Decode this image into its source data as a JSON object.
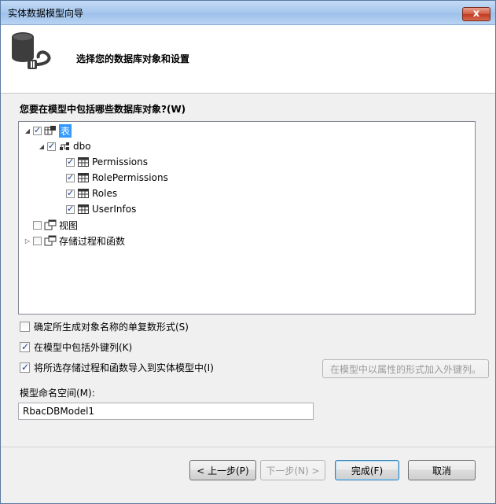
{
  "window": {
    "title": "实体数据模型向导",
    "close_label": "x"
  },
  "header": {
    "heading": "选择您的数据库对象和设置",
    "icon": "database-plug-icon"
  },
  "prompt": "您要在模型中包括哪些数据库对象?(W)",
  "tree": {
    "tables_label": "表",
    "schema_label": "dbo",
    "table_items": [
      "Permissions",
      "RolePermissions",
      "Roles",
      "UserInfos"
    ],
    "views_label": "视图",
    "procs_label": "存储过程和函数"
  },
  "options": {
    "pluralize_label": "确定所生成对象名称的单复数形式(S)",
    "pluralize_checked": false,
    "fk_label": "在模型中包括外键列(K)",
    "fk_checked": true,
    "import_label": "将所选存储过程和函数导入到实体模型中(I)",
    "import_checked": true,
    "add_fk_button": "在模型中以属性的形式加入外键列。"
  },
  "namespace": {
    "label": "模型命名空间(M):",
    "value": "RbacDBModel1"
  },
  "buttons": {
    "back": "< 上一步(P)",
    "next": "下一步(N) >",
    "finish": "完成(F)",
    "cancel": "取消"
  }
}
